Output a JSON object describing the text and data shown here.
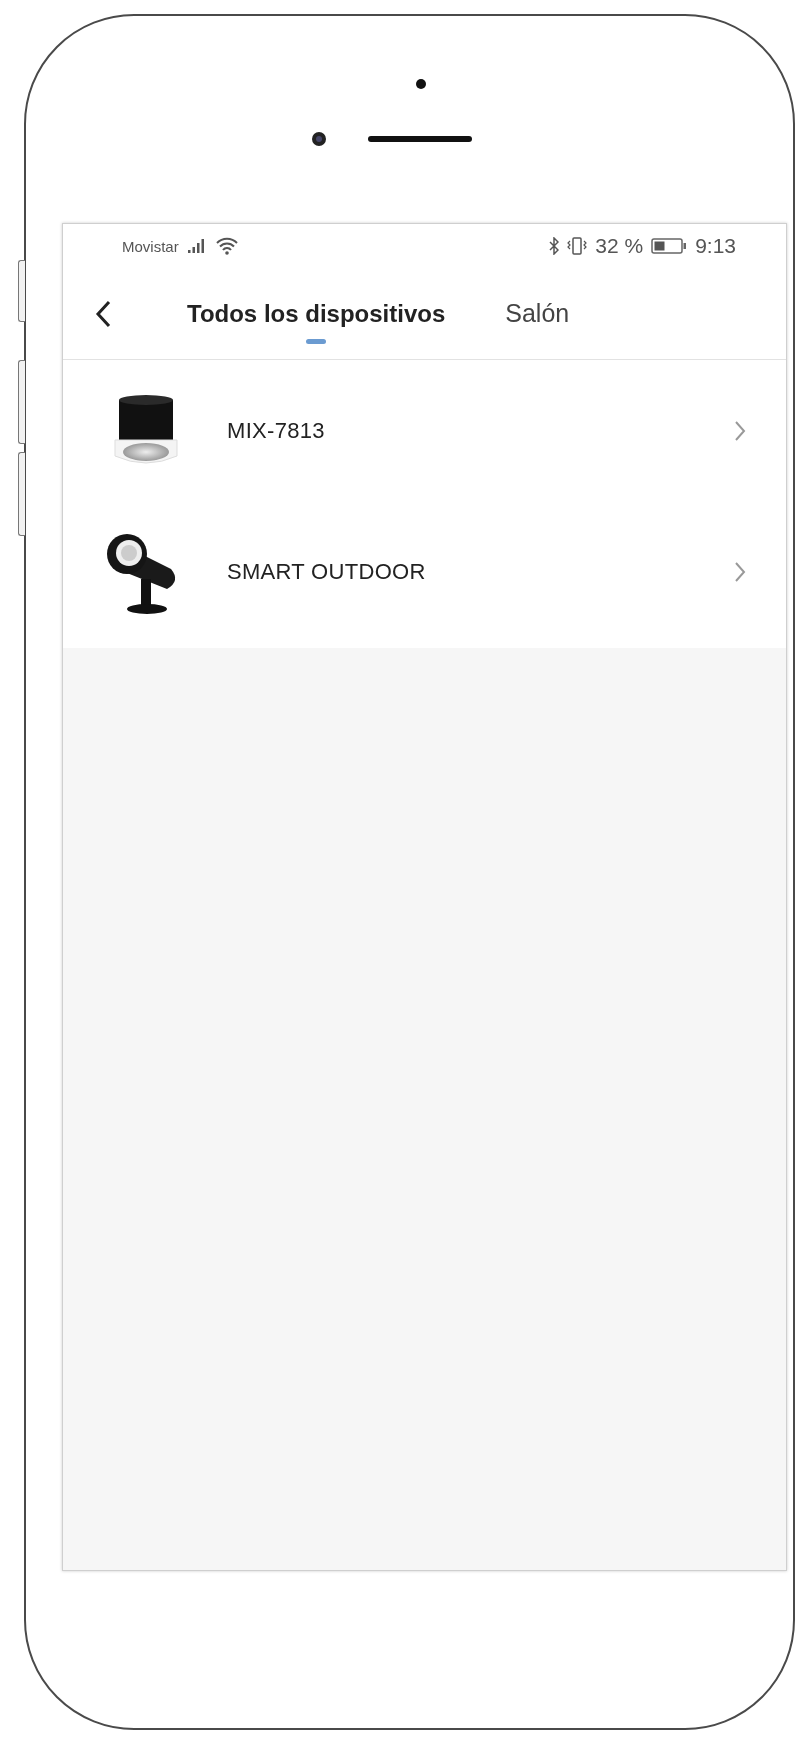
{
  "status_bar": {
    "carrier": "Movistar",
    "battery": "32 %",
    "time": "9:13"
  },
  "nav": {
    "tabs": [
      {
        "label": "Todos los dispositivos",
        "selected": true
      },
      {
        "label": "Salón",
        "selected": false
      }
    ]
  },
  "devices": [
    {
      "name": "MIX-7813",
      "kind": "downlight"
    },
    {
      "name": "SMART OUTDOOR",
      "kind": "spotlight"
    }
  ]
}
